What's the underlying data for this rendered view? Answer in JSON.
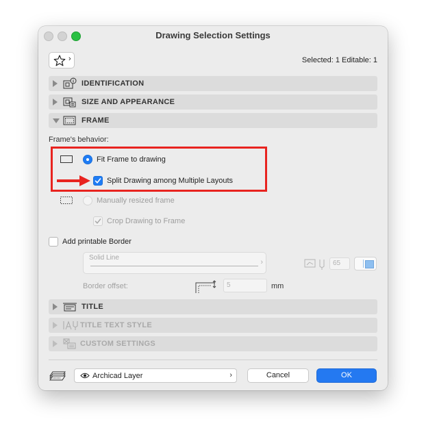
{
  "window": {
    "title": "Drawing Selection Settings"
  },
  "toolbar": {
    "favorites_chevron": "›"
  },
  "selection": {
    "info": "Selected: 1 Editable: 1"
  },
  "sections": {
    "identification": "IDENTIFICATION",
    "size_appearance": "SIZE AND APPEARANCE",
    "frame": "FRAME",
    "title": "TITLE",
    "title_text_style": "TITLE TEXT STYLE",
    "custom_settings": "CUSTOM SETTINGS"
  },
  "frame": {
    "behavior_label": "Frame's behavior:",
    "fit_frame_label": "Fit Frame to drawing",
    "fit_frame_selected": true,
    "split_drawing_label": "Split Drawing among Multiple Layouts",
    "split_drawing_checked": true,
    "manual_resize_label": "Manually resized frame",
    "manual_resize_selected": false,
    "crop_drawing_label": "Crop Drawing to Frame",
    "crop_drawing_checked": true
  },
  "border": {
    "add_border_label": "Add printable Border",
    "add_border_checked": false,
    "line_type": "Solid Line",
    "line_chevron": "›",
    "pen_number": "65",
    "offset_label": "Border offset:",
    "offset_value": "5",
    "offset_unit": "mm"
  },
  "footer": {
    "layer_name": "Archicad Layer",
    "layer_chevron": "›",
    "cancel_label": "Cancel",
    "ok_label": "OK"
  },
  "colors": {
    "accent": "#1f7cf4",
    "highlight": "#e8231f",
    "ok_button": "#2479f1"
  },
  "icons": [
    "star-icon",
    "identification-icon",
    "size-appearance-icon",
    "frame-icon",
    "title-icon",
    "title-text-style-icon",
    "custom-settings-icon",
    "fit-frame-icon",
    "manual-frame-icon",
    "red-arrow-icon",
    "pen-icon",
    "border-offset-icon",
    "layer-icon",
    "eye-icon"
  ]
}
